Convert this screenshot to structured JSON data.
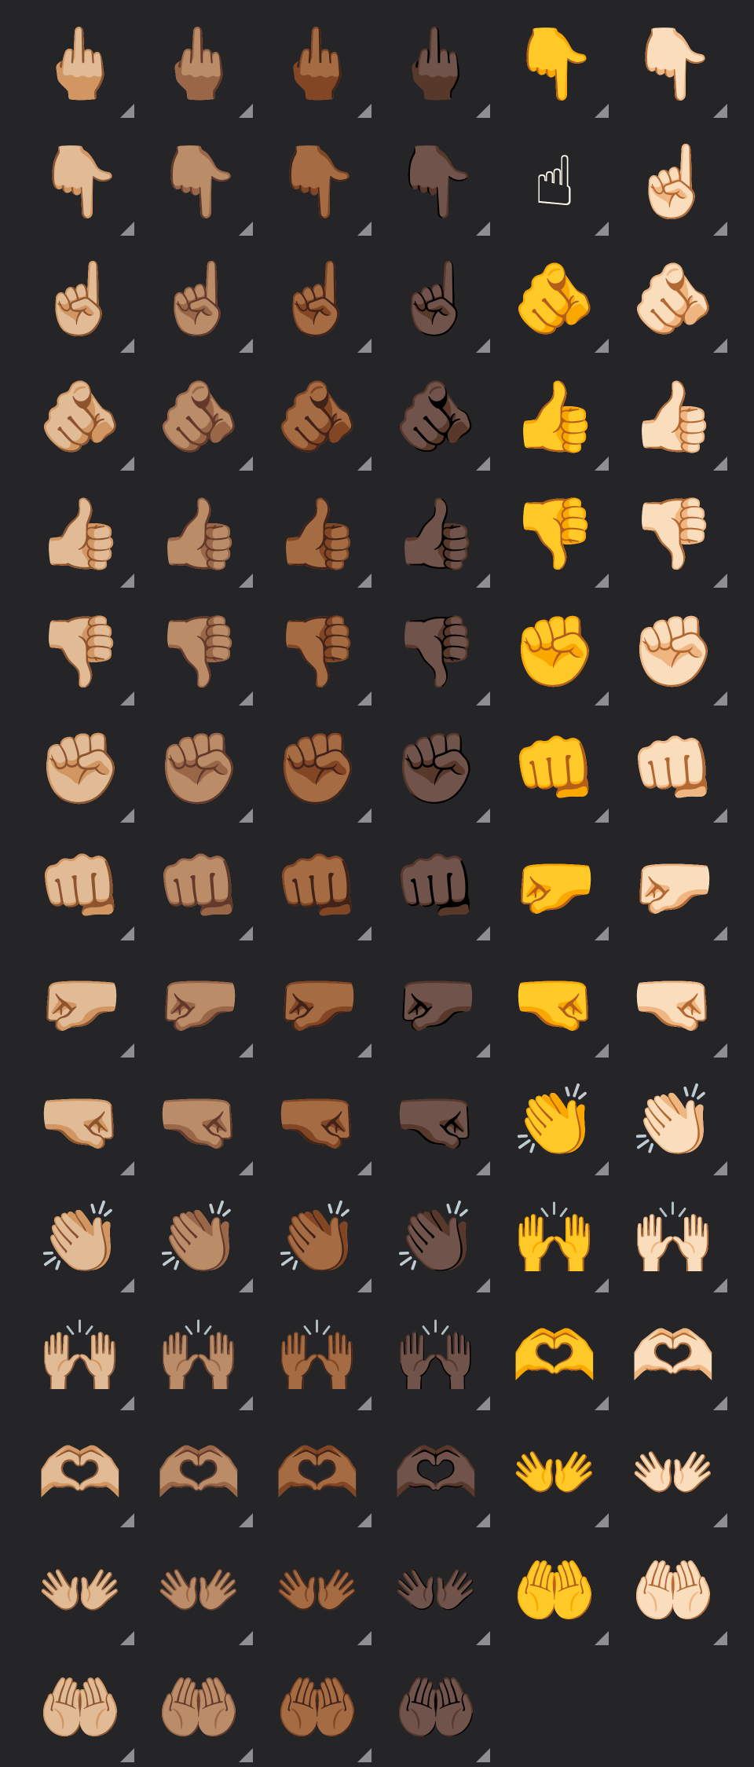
{
  "emoji_grid": {
    "columns": 6,
    "variant_marker": "triangle-corner-icon",
    "rows": [
      {
        "name": "middle-finger / backhand-index-pointing-down",
        "cells": [
          {
            "glyph": "🖕🏼",
            "skin": "#E7B98D"
          },
          {
            "glyph": "🖕🏽",
            "skin": "#C8936A"
          },
          {
            "glyph": "🖕🏾",
            "skin": "#A0683F"
          },
          {
            "glyph": "🖕🏿",
            "skin": "#5A3F33"
          },
          {
            "glyph": "👇",
            "skin": "#FFC83D"
          },
          {
            "glyph": "👇🏻",
            "skin": "#F3D7C2"
          }
        ]
      },
      {
        "name": "backhand-index-pointing-down / index-pointing-up",
        "cells": [
          {
            "glyph": "👇🏼",
            "skin": "#E7B98D"
          },
          {
            "glyph": "👇🏽",
            "skin": "#C8936A"
          },
          {
            "glyph": "👇🏾",
            "skin": "#A0683F"
          },
          {
            "glyph": "👇🏿",
            "skin": "#5A3F33"
          },
          {
            "glyph": "☝",
            "skin": "#FFC83D"
          },
          {
            "glyph": "☝🏻",
            "skin": "#F3D7C2"
          }
        ]
      },
      {
        "name": "index-pointing-up / index-pointing-at-viewer",
        "cells": [
          {
            "glyph": "☝🏼",
            "skin": "#E7B98D"
          },
          {
            "glyph": "☝🏽",
            "skin": "#C8936A"
          },
          {
            "glyph": "☝🏾",
            "skin": "#A0683F"
          },
          {
            "glyph": "☝🏿",
            "skin": "#5A3F33"
          },
          {
            "glyph": "🫵",
            "skin": "#FFC83D"
          },
          {
            "glyph": "🫵🏻",
            "skin": "#F3D7C2"
          }
        ]
      },
      {
        "name": "index-pointing-at-viewer / thumbs-up",
        "cells": [
          {
            "glyph": "🫵🏼",
            "skin": "#E7B98D"
          },
          {
            "glyph": "🫵🏽",
            "skin": "#C8936A"
          },
          {
            "glyph": "🫵🏾",
            "skin": "#A0683F"
          },
          {
            "glyph": "🫵🏿",
            "skin": "#5A3F33"
          },
          {
            "glyph": "👍",
            "skin": "#FFC83D"
          },
          {
            "glyph": "👍🏻",
            "skin": "#F3D7C2"
          }
        ]
      },
      {
        "name": "thumbs-up / thumbs-down",
        "cells": [
          {
            "glyph": "👍🏼",
            "skin": "#E7B98D"
          },
          {
            "glyph": "👍🏽",
            "skin": "#C8936A"
          },
          {
            "glyph": "👍🏾",
            "skin": "#A0683F"
          },
          {
            "glyph": "👍🏿",
            "skin": "#5A3F33"
          },
          {
            "glyph": "👎",
            "skin": "#FFC83D"
          },
          {
            "glyph": "👎🏻",
            "skin": "#F3D7C2"
          }
        ]
      },
      {
        "name": "thumbs-down / raised-fist",
        "cells": [
          {
            "glyph": "👎🏼",
            "skin": "#E7B98D"
          },
          {
            "glyph": "👎🏽",
            "skin": "#C8936A"
          },
          {
            "glyph": "👎🏾",
            "skin": "#A0683F"
          },
          {
            "glyph": "👎🏿",
            "skin": "#5A3F33"
          },
          {
            "glyph": "✊",
            "skin": "#FFC83D"
          },
          {
            "glyph": "✊🏻",
            "skin": "#F3D7C2"
          }
        ]
      },
      {
        "name": "raised-fist / oncoming-fist",
        "cells": [
          {
            "glyph": "✊🏼",
            "skin": "#E7B98D"
          },
          {
            "glyph": "✊🏽",
            "skin": "#C8936A"
          },
          {
            "glyph": "✊🏾",
            "skin": "#A0683F"
          },
          {
            "glyph": "✊🏿",
            "skin": "#5A3F33"
          },
          {
            "glyph": "👊",
            "skin": "#FFC83D"
          },
          {
            "glyph": "👊🏻",
            "skin": "#F3D7C2"
          }
        ]
      },
      {
        "name": "oncoming-fist / left-facing-fist",
        "cells": [
          {
            "glyph": "👊🏼",
            "skin": "#E7B98D"
          },
          {
            "glyph": "👊🏽",
            "skin": "#C8936A"
          },
          {
            "glyph": "👊🏾",
            "skin": "#A0683F"
          },
          {
            "glyph": "👊🏿",
            "skin": "#5A3F33"
          },
          {
            "glyph": "🤛",
            "skin": "#FFC83D"
          },
          {
            "glyph": "🤛🏻",
            "skin": "#F3D7C2"
          }
        ]
      },
      {
        "name": "left-facing-fist / right-facing-fist",
        "cells": [
          {
            "glyph": "🤛🏼",
            "skin": "#E7B98D"
          },
          {
            "glyph": "🤛🏽",
            "skin": "#C8936A"
          },
          {
            "glyph": "🤛🏾",
            "skin": "#A0683F"
          },
          {
            "glyph": "🤛🏿",
            "skin": "#5A3F33"
          },
          {
            "glyph": "🤜",
            "skin": "#FFC83D"
          },
          {
            "glyph": "🤜🏻",
            "skin": "#F3D7C2"
          }
        ]
      },
      {
        "name": "right-facing-fist / clapping-hands",
        "cells": [
          {
            "glyph": "🤜🏼",
            "skin": "#E7B98D"
          },
          {
            "glyph": "🤜🏽",
            "skin": "#C8936A"
          },
          {
            "glyph": "🤜🏾",
            "skin": "#A0683F"
          },
          {
            "glyph": "🤜🏿",
            "skin": "#5A3F33"
          },
          {
            "glyph": "👏",
            "skin": "#FFC83D"
          },
          {
            "glyph": "👏🏻",
            "skin": "#F3D7C2"
          }
        ]
      },
      {
        "name": "clapping-hands / raising-hands",
        "cells": [
          {
            "glyph": "👏🏼",
            "skin": "#E7B98D"
          },
          {
            "glyph": "👏🏽",
            "skin": "#C8936A"
          },
          {
            "glyph": "👏🏾",
            "skin": "#A0683F"
          },
          {
            "glyph": "👏🏿",
            "skin": "#5A3F33"
          },
          {
            "glyph": "🙌",
            "skin": "#FFC83D"
          },
          {
            "glyph": "🙌🏻",
            "skin": "#F3D7C2"
          }
        ]
      },
      {
        "name": "raising-hands / heart-hands",
        "cells": [
          {
            "glyph": "🙌🏼",
            "skin": "#E7B98D"
          },
          {
            "glyph": "🙌🏽",
            "skin": "#C8936A"
          },
          {
            "glyph": "🙌🏾",
            "skin": "#A0683F"
          },
          {
            "glyph": "🙌🏿",
            "skin": "#5A3F33"
          },
          {
            "glyph": "🫶",
            "skin": "#FFC83D"
          },
          {
            "glyph": "🫶🏻",
            "skin": "#F3D7C2"
          }
        ]
      },
      {
        "name": "heart-hands / open-hands",
        "cells": [
          {
            "glyph": "🫶🏼",
            "skin": "#E7B98D"
          },
          {
            "glyph": "🫶🏽",
            "skin": "#C8936A"
          },
          {
            "glyph": "🫶🏾",
            "skin": "#A0683F"
          },
          {
            "glyph": "🫶🏿",
            "skin": "#5A3F33"
          },
          {
            "glyph": "👐",
            "skin": "#FFC83D"
          },
          {
            "glyph": "👐🏻",
            "skin": "#F3D7C2"
          }
        ]
      },
      {
        "name": "open-hands / palms-up-together",
        "cells": [
          {
            "glyph": "👐🏼",
            "skin": "#E7B98D"
          },
          {
            "glyph": "👐🏽",
            "skin": "#C8936A"
          },
          {
            "glyph": "👐🏾",
            "skin": "#A0683F"
          },
          {
            "glyph": "👐🏿",
            "skin": "#5A3F33"
          },
          {
            "glyph": "🤲",
            "skin": "#FFC83D"
          },
          {
            "glyph": "🤲🏻",
            "skin": "#F3D7C2"
          }
        ]
      },
      {
        "name": "palms-up-together (partially visible)",
        "cells": [
          {
            "glyph": "🤲🏼",
            "skin": "#E7B98D"
          },
          {
            "glyph": "🤲🏽",
            "skin": "#C8936A"
          },
          {
            "glyph": "🤲🏾",
            "skin": "#A0683F"
          },
          {
            "glyph": "🤲🏿",
            "skin": "#5A3F33"
          }
        ]
      }
    ]
  }
}
